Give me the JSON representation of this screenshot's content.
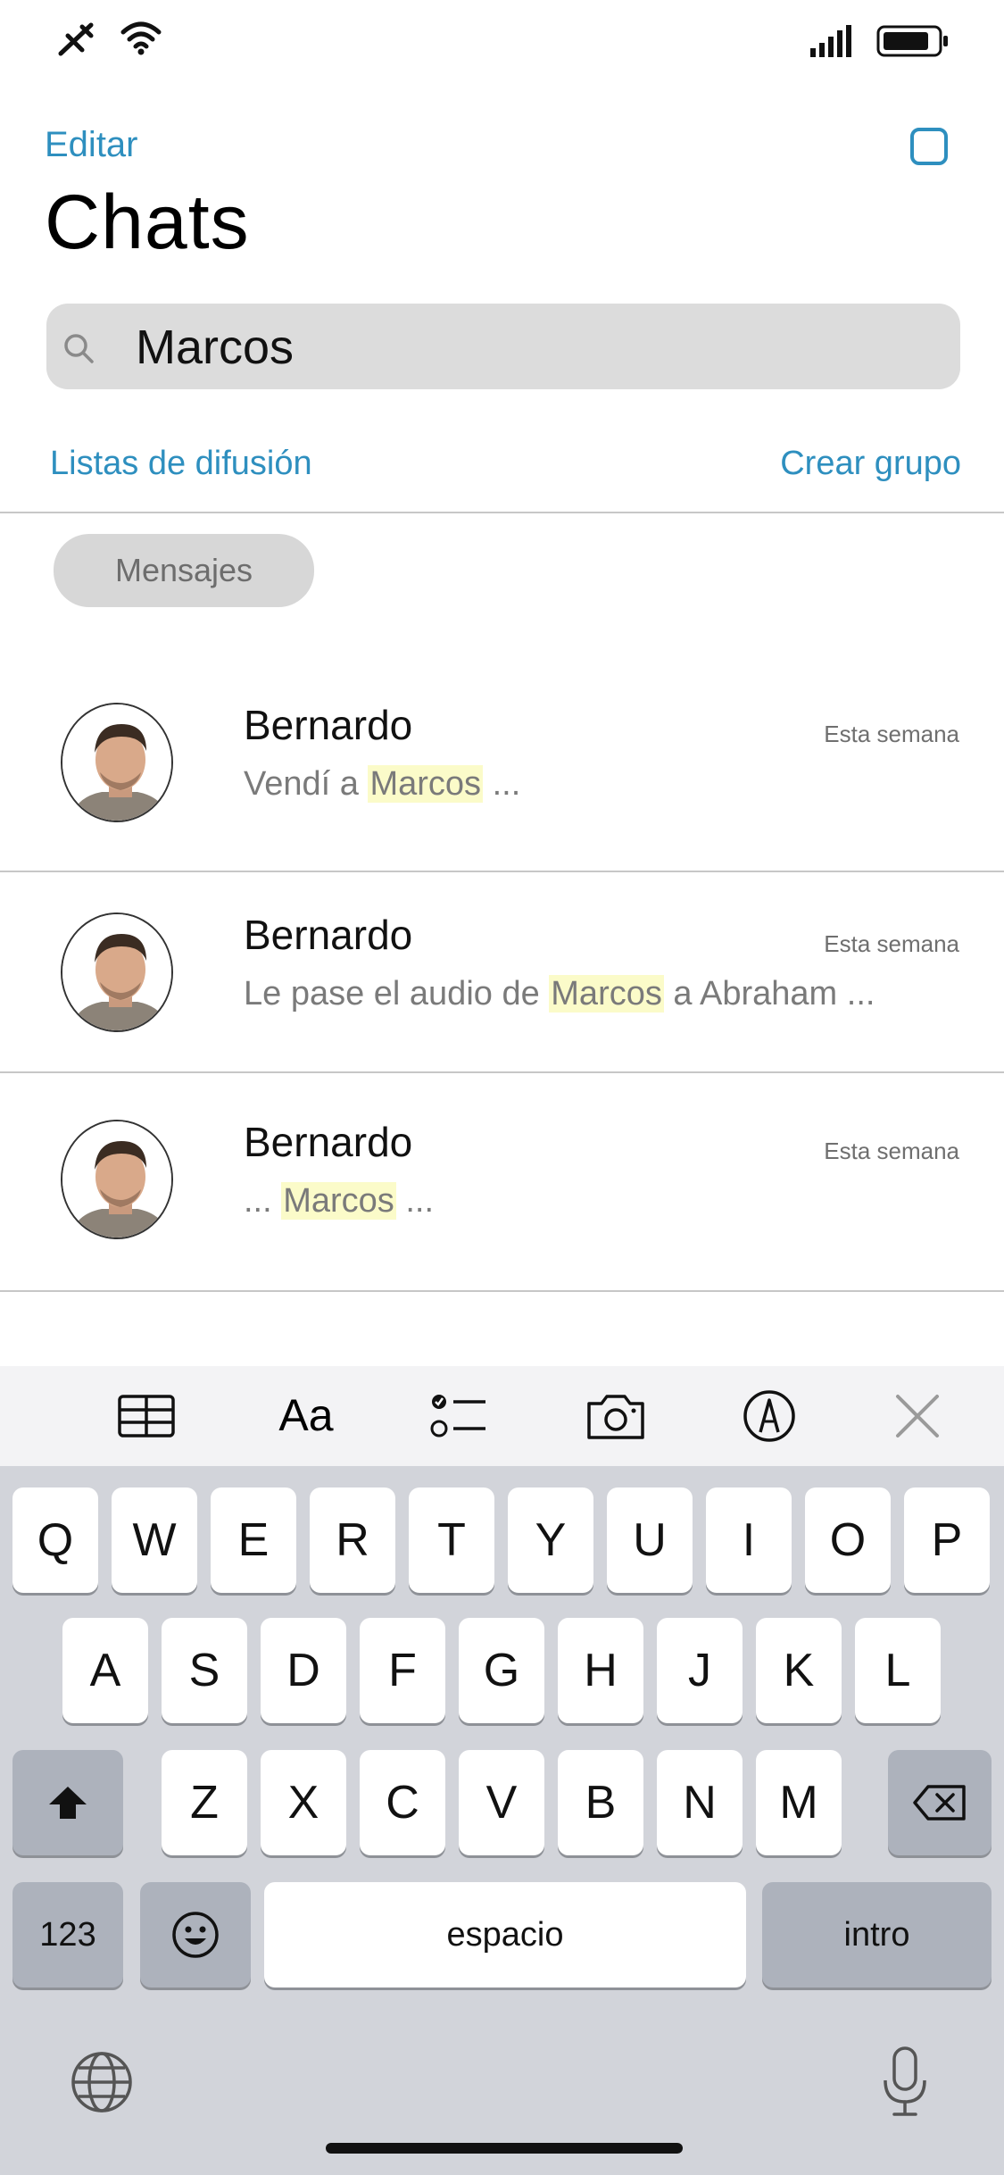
{
  "header": {
    "edit_label": "Editar",
    "title": "Chats",
    "compose_icon": "compose-square-icon"
  },
  "search": {
    "value": "Marcos"
  },
  "links": {
    "broadcast_label": "Listas de difusión",
    "new_group_label": "Crear grupo"
  },
  "filter": {
    "label": "Mensajes"
  },
  "chats": [
    {
      "name": "Bernardo",
      "time": "Esta semana",
      "before": "Vendí a ",
      "match": "Marcos",
      "after": " ..."
    },
    {
      "name": "Bernardo",
      "time": "Esta semana",
      "before": "Le pase el audio de ",
      "match": "Marcos",
      "after": " a Abraham ..."
    },
    {
      "name": "Bernardo",
      "time": "Esta semana",
      "before": "... ",
      "match": "Marcos",
      "after": " ..."
    }
  ],
  "toolbar": {
    "icons": [
      "table-icon",
      "text-format-icon",
      "checklist-icon",
      "camera-icon",
      "markup-pen-icon",
      "close-icon"
    ],
    "format_label": "Aa"
  },
  "keyboard": {
    "row1": [
      "Q",
      "W",
      "E",
      "R",
      "T",
      "Y",
      "U",
      "I",
      "O",
      "P"
    ],
    "row2": [
      "A",
      "S",
      "D",
      "F",
      "G",
      "H",
      "J",
      "K",
      "L"
    ],
    "row3": [
      "Z",
      "X",
      "C",
      "V",
      "B",
      "N",
      "M"
    ],
    "numbers_label": "123",
    "space_label": "espacio",
    "return_label": "intro"
  },
  "colors": {
    "accent": "#2e8fbf",
    "highlight": "#fbfbc9",
    "keyboard_bg": "#d2d4da"
  }
}
